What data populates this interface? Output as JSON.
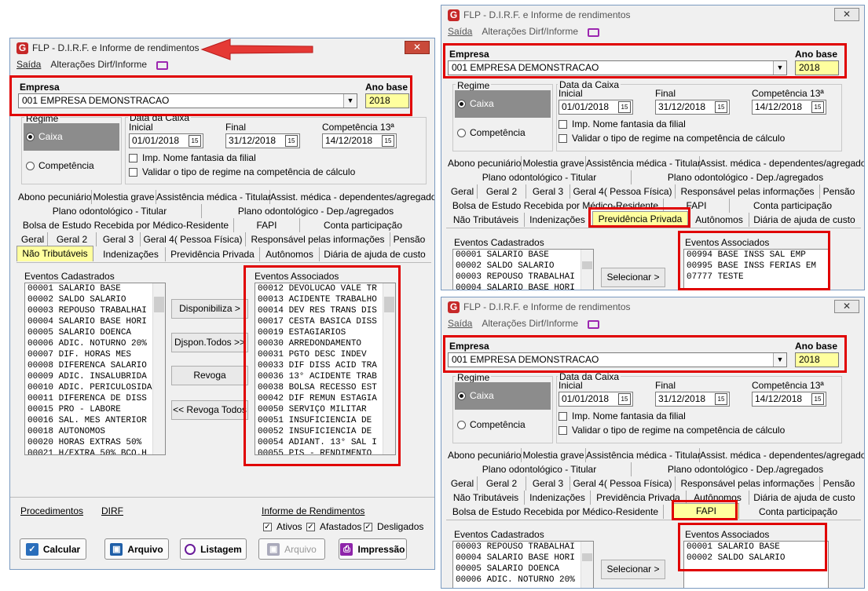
{
  "title": "FLP - D.I.R.F. e Informe de rendimentos",
  "close_label": "✕",
  "menu": {
    "saida": "Saída",
    "alteracoes": "Alterações Dirf/Informe"
  },
  "empresa": {
    "label": "Empresa",
    "value": "001 EMPRESA DEMONSTRACAO"
  },
  "ano_base": {
    "label": "Ano base",
    "value": "2018"
  },
  "regime": {
    "label": "Regime",
    "caixa": "Caixa",
    "competencia": "Competência"
  },
  "data_caixa": {
    "label": "Data da Caixa",
    "inicial_label": "Inicial",
    "final_label": "Final",
    "comp13_label": "Competência 13ª",
    "inicial": "01/01/2018",
    "final": "31/12/2018",
    "comp13": "14/12/2018"
  },
  "checks": {
    "fantasia": "Imp. Nome fantasia da filial",
    "validar": "Validar o tipo de regime na competência de cálculo"
  },
  "tabs_main": {
    "row1": [
      "Abono pecuniário",
      "Molestia grave",
      "Assistência médica - Titular",
      "Assist. médica - dependentes/agregados"
    ],
    "row2": [
      "Plano odontológico - Titular",
      "Plano odontológico - Dep./agregados"
    ],
    "row3": [
      "Bolsa de Estudo Recebida por Médico-Residente",
      "FAPI",
      "Conta participação"
    ],
    "row4": [
      "Geral",
      "Geral 2",
      "Geral 3",
      "Geral 4( Pessoa Física)",
      "Responsável pelas informações",
      "Pensão"
    ],
    "row5": [
      "Não Tributáveis",
      "Indenizações",
      "Previdência Privada",
      "Autônomos",
      "Diária de ajuda de custo"
    ]
  },
  "tabs_b": {
    "row1": [
      "Abono pecuniário",
      "Molestia grave",
      "Assistência médica - Titular",
      "Assist. médica - dependentes/agregados"
    ],
    "row2": [
      "Plano odontológico - Titular",
      "Plano odontológico - Dep./agregados"
    ],
    "row3": [
      "Geral",
      "Geral 2",
      "Geral 3",
      "Geral 4( Pessoa Física)",
      "Responsável pelas informações",
      "Pensão"
    ],
    "row4": [
      "Bolsa de Estudo Recebida por Médico-Residente",
      "FAPI",
      "Conta participação"
    ],
    "row5": [
      "Não Tributáveis",
      "Indenizações",
      "Previdência Privada",
      "Autônomos",
      "Diária de ajuda de custo"
    ]
  },
  "tabs_c": {
    "row1": [
      "Abono pecuniário",
      "Molestia grave",
      "Assistência médica - Titular",
      "Assist. médica - dependentes/agregados"
    ],
    "row2": [
      "Plano odontológico - Titular",
      "Plano odontológico - Dep./agregados"
    ],
    "row3": [
      "Geral",
      "Geral 2",
      "Geral 3",
      "Geral 4( Pessoa Física)",
      "Responsável pelas informações",
      "Pensão"
    ],
    "row4": [
      "Não Tributáveis",
      "Indenizações",
      "Previdência Privada",
      "Autônomos",
      "Diária de ajuda de custo"
    ],
    "row5": [
      "Bolsa de Estudo Recebida por Médico-Residente",
      "FAPI",
      "Conta participação"
    ]
  },
  "eventos_cadastrados_label": "Eventos Cadastrados",
  "eventos_associados_label": "Eventos Associados",
  "main_cadastrados": [
    "00001 SALARIO BASE",
    "00002 SALDO SALARIO",
    "00003 REPOUSO TRABALHAI",
    "00004 SALARIO BASE HORI",
    "00005 SALARIO DOENCA",
    "00006 ADIC. NOTURNO 20%",
    "00007 DIF. HORAS MES",
    "00008 DIFERENCA SALARIO",
    "00009 ADIC. INSALUBRIDA",
    "00010 ADIC. PERICULOSIDA",
    "00011 DIFERENCA DE DISS",
    "00015 PRO - LABORE",
    "00016 SAL. MES ANTERIOR",
    "00018 AUTONOMOS",
    "00020 HORAS EXTRAS 50%",
    "00021 H/EXTRA 50% BCO.H"
  ],
  "main_associados": [
    "00012 DEVOLUCAO VALE TR",
    "00013 ACIDENTE TRABALHO",
    "00014 DEV RES TRANS DIS",
    "00017 CESTA BASICA DISS",
    "00019 ESTAGIARIOS",
    "00030 ARREDONDAMENTO",
    "00031 PGTO DESC INDEV",
    "00033 DIF DISS ACID TRA",
    "00036 13° ACIDENTE TRAB",
    "00038 BOLSA RECESSO EST",
    "00042 DIF REMUN ESTAGIA",
    "00050 SERVIÇO MILITAR",
    "00051 INSUFICIENCIA DE",
    "00052 INSUFICIENCIA DE",
    "00054 ADIANT. 13° SAL I",
    "00055 PIS - RENDIMENTO"
  ],
  "buttons": {
    "disponibiliza": "Disponibiliza >",
    "dispon_todos": "Djspon.Todos >>",
    "revoga": "Revoga",
    "revoga_todos": "<< Revoga Todos",
    "selecionar": "Selecionar >"
  },
  "footer": {
    "procedimentos": "Procedimentos",
    "dirf": "DIRF",
    "informe": "Informe de Rendimentos",
    "ativos": "Ativos",
    "afastados": "Afastados",
    "desligados": "Desligados",
    "calcular": "Calcular",
    "arquivo": "Arquivo",
    "listagem": "Listagem",
    "arquivo2": "Arquivo",
    "impressao": "Impressão"
  },
  "b_cadastrados": [
    "00001 SALARIO BASE",
    "00002 SALDO SALARIO",
    "00003 REPOUSO TRABALHAI",
    "00004 SALARIO BASE HORI"
  ],
  "b_associados": [
    "00994 BASE INSS SAL EMP",
    "00995 BASE INSS FERIAS EM",
    "07777 TESTE"
  ],
  "c_cadastrados": [
    "00003 REPOUSO TRABALHAI",
    "00004 SALARIO BASE HORI",
    "00005 SALARIO DOENCA",
    "00006 ADIC. NOTURNO 20%"
  ],
  "c_associados": [
    "00001 SALARIO BASE",
    "00002 SALDO SALARIO"
  ],
  "colors": {
    "annotation": "#e00000",
    "highlight": "#ffff9e",
    "accent": "#9c27b0"
  }
}
